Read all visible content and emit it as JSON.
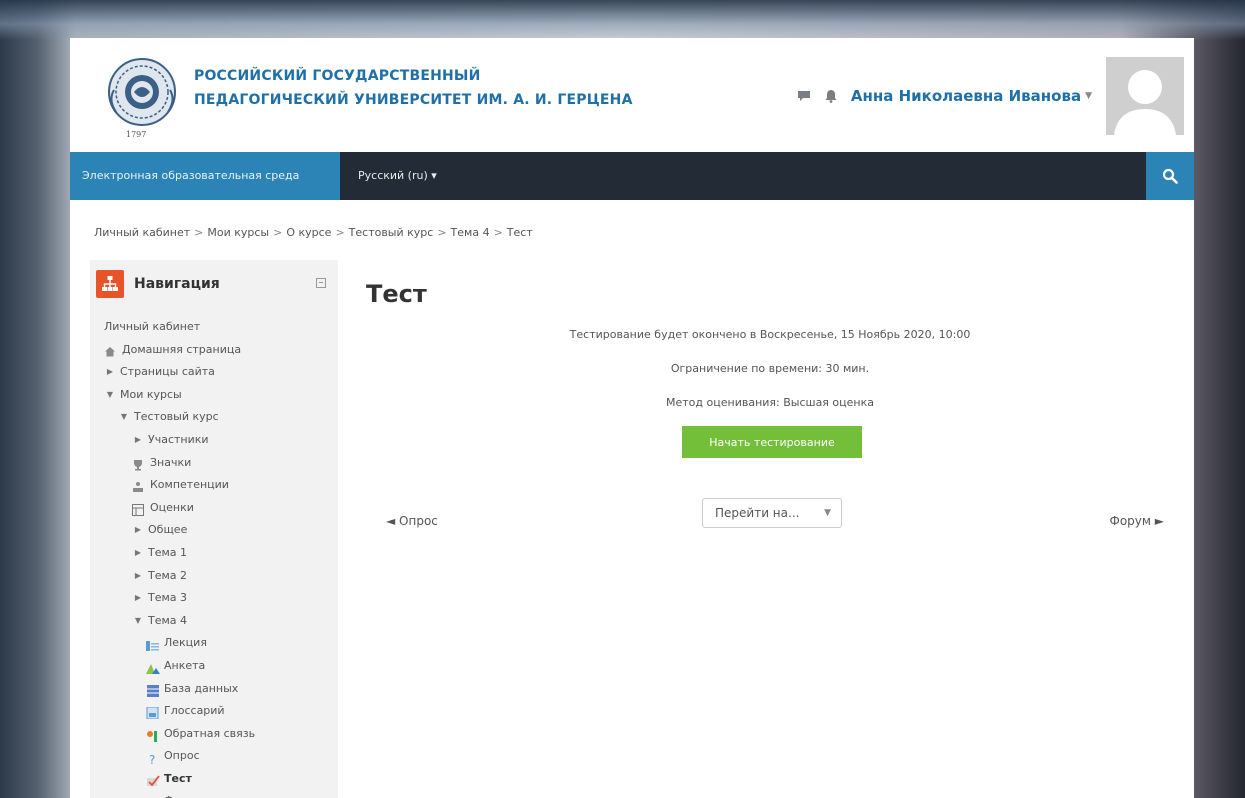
{
  "header": {
    "logo_year": "1797",
    "university_line1": "РОССИЙСКИЙ ГОСУДАРСТВЕННЫЙ",
    "university_line2": "ПЕДАГОГИЧЕСКИЙ УНИВЕРСИТЕТ ИМ. А. И. ГЕРЦЕНА",
    "user_name": "Анна Николаевна Иванова",
    "icons": [
      "chat-icon",
      "notification-bell-icon"
    ]
  },
  "navbar": {
    "brand": "Электронная образовательная среда",
    "language": "Русский (ru) ▾",
    "search_icon": "search-icon"
  },
  "breadcrumb": [
    "Личный кабинет",
    "Мои курсы",
    "О курсе",
    "Тестовый курс",
    "Тема 4",
    "Тест"
  ],
  "navigation": {
    "title": "Навигация",
    "items": [
      {
        "label": "Личный кабинет",
        "level": 0,
        "toggle": "",
        "icon": ""
      },
      {
        "label": "Домашняя страница",
        "level": 0,
        "toggle": "",
        "icon": "home-icon"
      },
      {
        "label": "Страницы сайта",
        "level": 0,
        "toggle": "▶",
        "icon": ""
      },
      {
        "label": "Мои курсы",
        "level": 0,
        "toggle": "▼",
        "icon": ""
      },
      {
        "label": "Тестовый курс",
        "level": 1,
        "toggle": "▼",
        "icon": ""
      },
      {
        "label": "Участники",
        "level": 2,
        "toggle": "▶",
        "icon": ""
      },
      {
        "label": "Значки",
        "level": 2,
        "toggle": "",
        "icon": "trophy-icon"
      },
      {
        "label": "Компетенции",
        "level": 2,
        "toggle": "",
        "icon": "competency-icon"
      },
      {
        "label": "Оценки",
        "level": 2,
        "toggle": "",
        "icon": "grades-icon"
      },
      {
        "label": "Общее",
        "level": 2,
        "toggle": "▶",
        "icon": ""
      },
      {
        "label": "Тема 1",
        "level": 2,
        "toggle": "▶",
        "icon": ""
      },
      {
        "label": "Тема 2",
        "level": 2,
        "toggle": "▶",
        "icon": ""
      },
      {
        "label": "Тема 3",
        "level": 2,
        "toggle": "▶",
        "icon": ""
      },
      {
        "label": "Тема 4",
        "level": 2,
        "toggle": "▼",
        "icon": ""
      },
      {
        "label": "Лекция",
        "level": 3,
        "toggle": "",
        "icon": "lesson-icon"
      },
      {
        "label": "Анкета",
        "level": 3,
        "toggle": "",
        "icon": "survey-icon"
      },
      {
        "label": "База данных",
        "level": 3,
        "toggle": "",
        "icon": "database-icon"
      },
      {
        "label": "Глоссарий",
        "level": 3,
        "toggle": "",
        "icon": "glossary-icon"
      },
      {
        "label": "Обратная связь",
        "level": 3,
        "toggle": "",
        "icon": "feedback-icon"
      },
      {
        "label": "Опрос",
        "level": 3,
        "toggle": "",
        "icon": "choice-icon"
      },
      {
        "label": "Тест",
        "level": 3,
        "toggle": "",
        "icon": "quiz-icon",
        "current": true
      },
      {
        "label": "Форум",
        "level": 3,
        "toggle": "",
        "icon": "forum-icon"
      }
    ]
  },
  "main": {
    "title": "Тест",
    "close_info": "Тестирование будет окончено в Воскресенье, 15 Ноябрь 2020, 10:00",
    "time_limit": "Ограничение по времени: 30 мин.",
    "grading_method": "Метод оценивания: Высшая оценка",
    "start_button": "Начать тестирование",
    "prev_link": "◄ Опрос",
    "next_link": "Форум ►",
    "jump_select": "Перейти на..."
  },
  "colors": {
    "accent_blue": "#2b83b6",
    "navbar_dark": "#222b36",
    "start_green": "#74bf3a",
    "nav_orange": "#e8542a"
  }
}
